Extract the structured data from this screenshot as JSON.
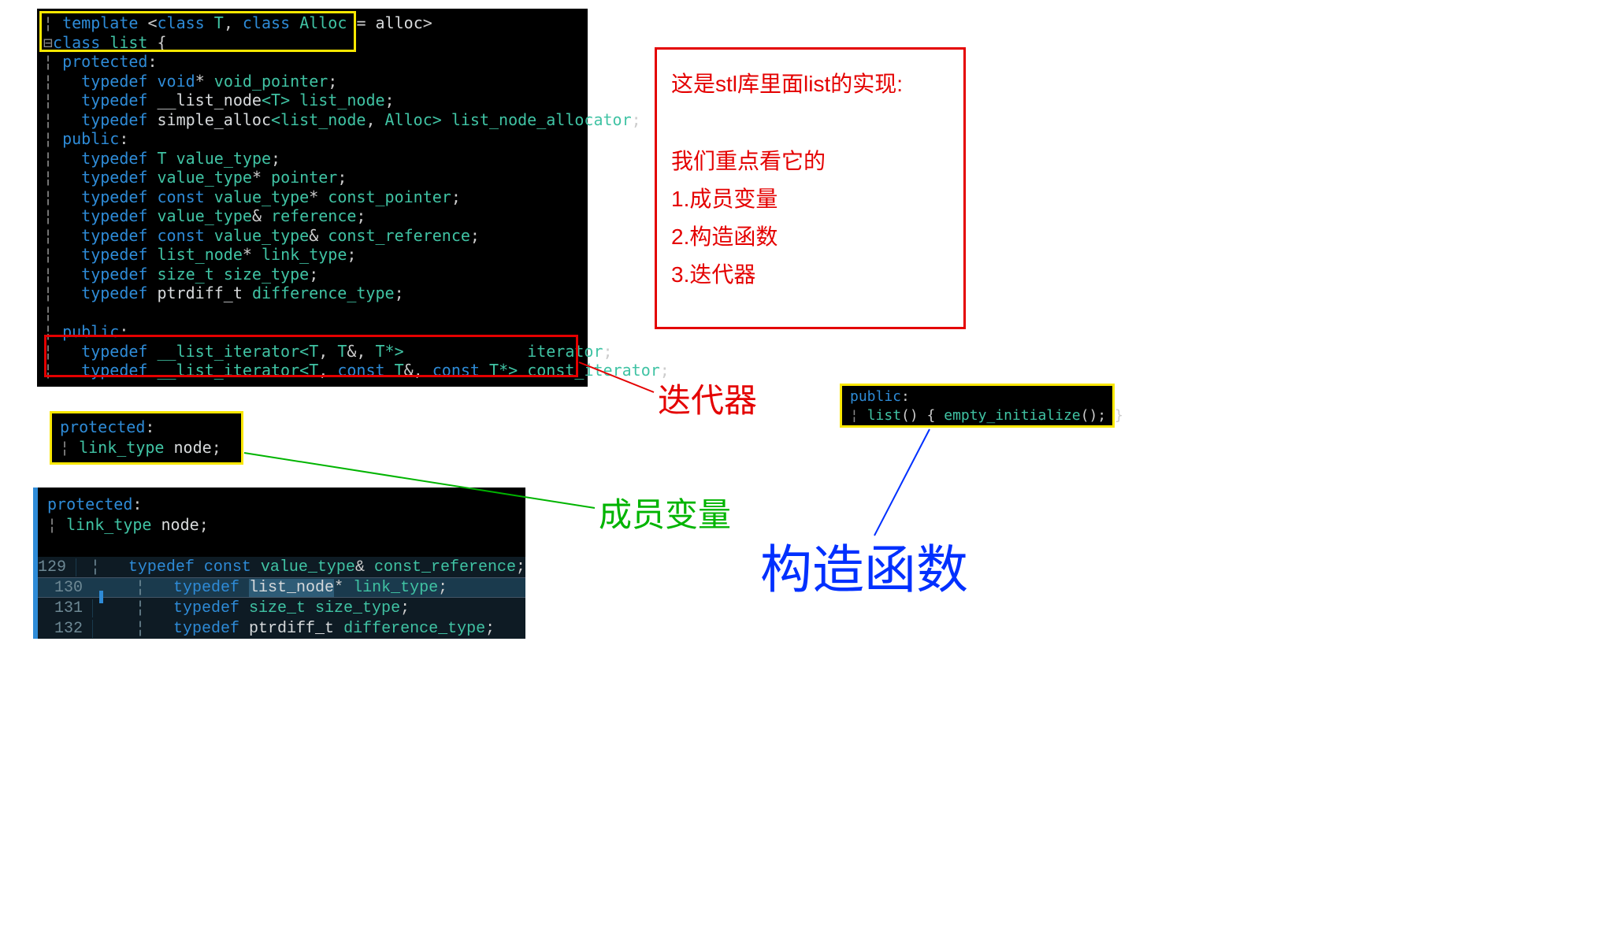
{
  "main_code": {
    "l1_kw1": "template",
    "l1_op1": " <",
    "l1_kw2": "class",
    "l1_sp1": " ",
    "l1_id1": "T",
    "l1_op2": ", ",
    "l1_kw3": "class",
    "l1_sp2": " ",
    "l1_id2": "Alloc",
    "l1_op3": " = ",
    "l1_id3": "alloc",
    "l1_op4": ">",
    "l2_kw": "class",
    "l2_sp": " ",
    "l2_id": "list",
    "l2_op": " {",
    "l3": "protected",
    "l3_op": ":",
    "l4_kw": "typedef",
    "l4_sp": " ",
    "l4_kw2": "void",
    "l4_op": "* ",
    "l4_id": "void_pointer",
    "l4_semi": ";",
    "l5_kw": "typedef",
    "l5_sp": " ",
    "l5_id": "__list_node",
    "l5_op1": "<",
    "l5_id2": "T",
    "l5_op2": "> ",
    "l5_id3": "list_node",
    "l5_semi": ";",
    "l6_kw": "typedef",
    "l6_sp": " ",
    "l6_id": "simple_alloc",
    "l6_op1": "<",
    "l6_id2": "list_node",
    "l6_op2": ", ",
    "l6_id3": "Alloc",
    "l6_op3": "> ",
    "l6_id4": "list_node_allocator",
    "l6_semi": ";",
    "l7": "public",
    "l7_op": ":",
    "l8_kw": "typedef",
    "l8_sp": " ",
    "l8_id": "T",
    "l8_sp2": " ",
    "l8_id2": "value_type",
    "l8_semi": ";",
    "l9_kw": "typedef",
    "l9_sp": " ",
    "l9_id": "value_type",
    "l9_op": "* ",
    "l9_id2": "pointer",
    "l9_semi": ";",
    "l10_kw": "typedef",
    "l10_sp": " ",
    "l10_kw2": "const",
    "l10_sp2": " ",
    "l10_id": "value_type",
    "l10_op": "* ",
    "l10_id2": "const_pointer",
    "l10_semi": ";",
    "l11_kw": "typedef",
    "l11_sp": " ",
    "l11_id": "value_type",
    "l11_op": "& ",
    "l11_id2": "reference",
    "l11_semi": ";",
    "l12_kw": "typedef",
    "l12_sp": " ",
    "l12_kw2": "const",
    "l12_sp2": " ",
    "l12_id": "value_type",
    "l12_op": "& ",
    "l12_id2": "const_reference",
    "l12_semi": ";",
    "l13_kw": "typedef",
    "l13_sp": " ",
    "l13_id": "list_node",
    "l13_op": "* ",
    "l13_id2": "link_type",
    "l13_semi": ";",
    "l14_kw": "typedef",
    "l14_sp": " ",
    "l14_id": "size_t",
    "l14_sp2": " ",
    "l14_id2": "size_type",
    "l14_semi": ";",
    "l15_kw": "typedef",
    "l15_sp": " ",
    "l15_id": "ptrdiff_t",
    "l15_sp2": " ",
    "l15_id2": "difference_type",
    "l15_semi": ";",
    "l17": "public",
    "l17_op": ":",
    "l18_kw": "typedef",
    "l18_sp": " ",
    "l18_id": "__list_iterator",
    "l18_op1": "<",
    "l18_id2": "T",
    "l18_op2": ", ",
    "l18_id3": "T",
    "l18_op3": "&, ",
    "l18_id4": "T",
    "l18_op4": "*>",
    "l18_pad": "             ",
    "l18_id5": "iterator",
    "l18_semi": ";",
    "l19_kw": "typedef",
    "l19_sp": " ",
    "l19_id": "__list_iterator",
    "l19_op1": "<",
    "l19_id2": "T",
    "l19_op2": ", ",
    "l19_kw2": "const",
    "l19_sp2": " ",
    "l19_id3": "T",
    "l19_op3": "&, ",
    "l19_kw3": "const",
    "l19_sp3": " ",
    "l19_id4": "T",
    "l19_op4": "*> ",
    "l19_id5": "const_iterator",
    "l19_semi": ";"
  },
  "note": {
    "heading": "这是stl库里面list的实现:",
    "line1": "我们重点看它的",
    "line2": "1.成员变量",
    "line3": "2.构造函数",
    "line4": "3.迭代器"
  },
  "member_box": {
    "l1": "protected",
    "l1_op": ":",
    "l2_id": "link_type",
    "l2_sp": " ",
    "l2_id2": "node",
    "l2_semi": ";"
  },
  "code3": {
    "top_l1": "protected",
    "top_l1_op": ":",
    "top_l2_id": "link_type",
    "top_l2_sp": " ",
    "top_l2_id2": "node",
    "top_l2_semi": ";",
    "rows": [
      {
        "ln": "129",
        "pre": "typedef ",
        "kw": "const",
        "mid": " value_type",
        "amp": "& ",
        "tail": "const_reference",
        ";": ";"
      },
      {
        "ln": "130",
        "pre": "typedef ",
        "sel": "list_node",
        "star": "* ",
        "tail": "link_type",
        ";": ";",
        "hl": true
      },
      {
        "ln": "131",
        "pre": "typedef ",
        "id": "size_t ",
        "tail": "size_type",
        ";": ";"
      },
      {
        "ln": "132",
        "pre": "typedef ",
        "id": "ptrdiff_t ",
        "tail": "difference_type",
        ";": ";"
      }
    ]
  },
  "ctor_box": {
    "l1": "public",
    "l1_op": ":",
    "l2_id": "list",
    "l2_op1": "() { ",
    "l2_id2": "empty_initialize",
    "l2_op2": "(); }"
  },
  "labels": {
    "iterator": "迭代器",
    "member": "成员变量",
    "constructor": "构造函数"
  }
}
